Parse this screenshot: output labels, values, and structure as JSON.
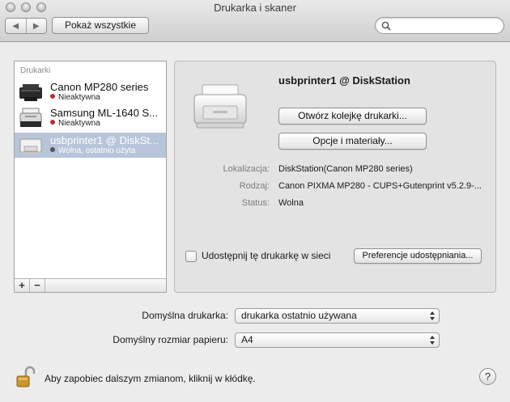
{
  "window": {
    "title": "Drukarka i skaner"
  },
  "toolbar": {
    "back_glyph": "◀",
    "forward_glyph": "▶",
    "show_all_label": "Pokaż wszystkie",
    "search_placeholder": "",
    "search_icon": "search-icon"
  },
  "printer_list": {
    "header": "Drukarki",
    "items": [
      {
        "name": "Canon MP280 series",
        "status": "Nieaktywna",
        "status_color": "#c62a2a",
        "selected": false
      },
      {
        "name": "Samsung ML-1640 S...",
        "status": "Nieaktywna",
        "status_color": "#c62a2a",
        "selected": false
      },
      {
        "name": "usbprinter1 @ DiskSt...",
        "status": "Wolna, ostatnio użyta",
        "status_color": "#555555",
        "selected": true
      }
    ],
    "add_label": "+",
    "remove_label": "−"
  },
  "detail": {
    "title": "usbprinter1 @ DiskStation",
    "open_queue_label": "Otwórz kolejkę drukarki...",
    "options_label": "Opcje i materiały...",
    "location_label": "Lokalizacja:",
    "location_value": "DiskStation(Canon MP280 series)",
    "kind_label": "Rodzaj:",
    "kind_value": "Canon PIXMA MP280 - CUPS+Gutenprint v5.2.9-...",
    "status_label": "Status:",
    "status_value": "Wolna",
    "share_label": "Udostępnij tę drukarkę w sieci",
    "share_prefs_label": "Preferencje udostępniania..."
  },
  "defaults": {
    "printer_label": "Domyślna drukarka:",
    "printer_value": "drukarka ostatnio używana",
    "paper_label": "Domyślny rozmiar papieru:",
    "paper_value": "A4"
  },
  "footer": {
    "lock_text": "Aby zapobiec dalszym zmianom, kliknij w kłódkę.",
    "help_label": "?"
  },
  "colors": {
    "selection": "#b7c4d9",
    "inactive_dot": "#c62a2a"
  }
}
